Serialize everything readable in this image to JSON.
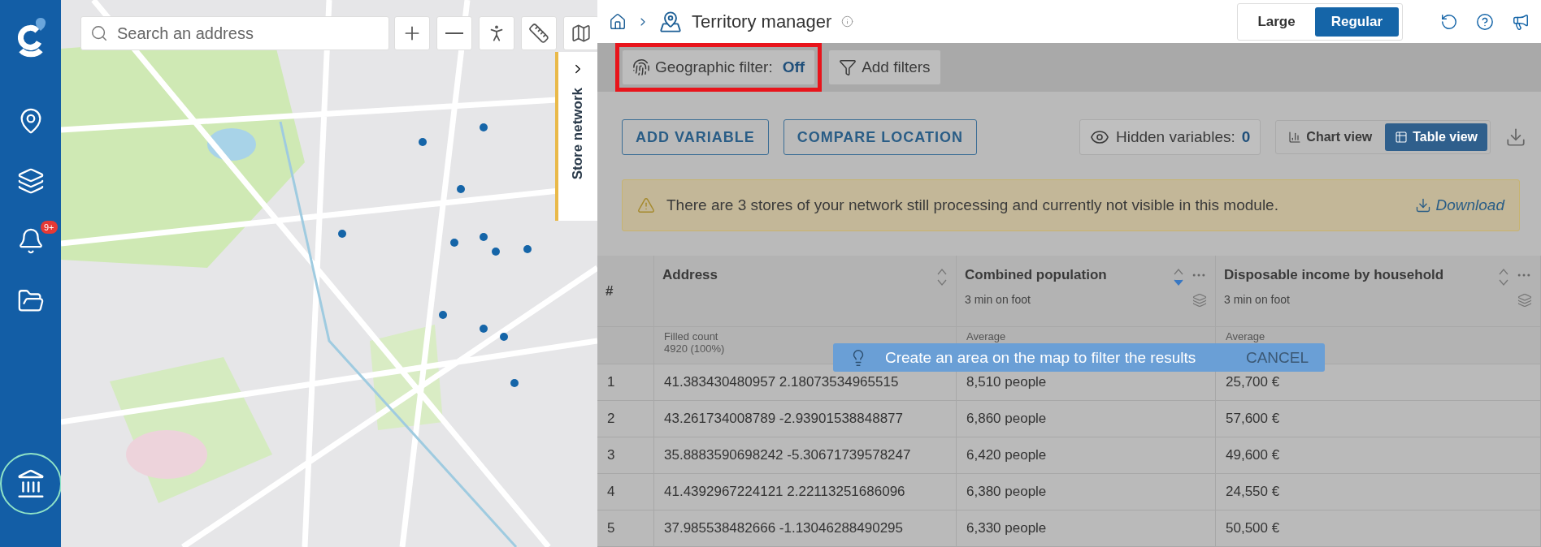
{
  "sidebar": {
    "items": [
      {
        "kind": "pin",
        "selected": false
      },
      {
        "kind": "layers",
        "selected": false
      },
      {
        "kind": "bell",
        "selected": false,
        "badge": "9+"
      },
      {
        "kind": "folder",
        "selected": false
      },
      {
        "kind": "bank",
        "selected": true
      }
    ]
  },
  "map": {
    "search": {
      "placeholder": "Search an address"
    },
    "side_tab": {
      "label": "Store network"
    }
  },
  "header": {
    "title": "Territory manager",
    "size_toggle": [
      {
        "label": "Large",
        "selected": false
      },
      {
        "label": "Regular",
        "selected": true
      }
    ]
  },
  "filter_bar": {
    "geographic_filter": {
      "label": "Geographic filter:",
      "value": "Off",
      "highlighted": true
    },
    "add_filters": "Add filters"
  },
  "toolbar": {
    "buttons": [
      "ADD VARIABLE",
      "COMPARE LOCATION"
    ],
    "hidden_variables": {
      "label": "Hidden variables:",
      "count": "0"
    },
    "views": [
      {
        "label": "Chart view",
        "kind": "chart",
        "selected": false
      },
      {
        "label": "Table view",
        "kind": "table",
        "selected": true
      }
    ]
  },
  "warning": {
    "text": "There are 3 stores of your network still processing and currently not visible in this module.",
    "link": "Download"
  },
  "table": {
    "columns": [
      {
        "title": "#"
      },
      {
        "title": "Address",
        "sorted_descending": false,
        "summary_label": "Filled count",
        "summary_value": "4920 (100%)"
      },
      {
        "title": "Combined population",
        "subtitle": "3 min on foot",
        "sorted_descending": true,
        "summary_label": "Average"
      },
      {
        "title": "Disposable income by household",
        "subtitle": "3 min on foot",
        "sorted_descending": false,
        "summary_label": "Average"
      }
    ],
    "rows": [
      [
        "1",
        "41.383430480957 2.18073534965515",
        "8,510 people",
        "25,700 €"
      ],
      [
        "2",
        "43.261734008789 -2.93901538848877",
        "6,860 people",
        "57,600 €"
      ],
      [
        "3",
        "35.8883590698242 -5.30671739578247",
        "6,420 people",
        "49,600 €"
      ],
      [
        "4",
        "41.4392967224121 2.22113251686096",
        "6,380 people",
        "24,550 €"
      ],
      [
        "5",
        "37.985538482666 -1.13046288490295",
        "6,330 people",
        "50,500 €"
      ]
    ]
  },
  "toast": {
    "text": "Create an area on the map to filter the results",
    "action": "CANCEL"
  }
}
